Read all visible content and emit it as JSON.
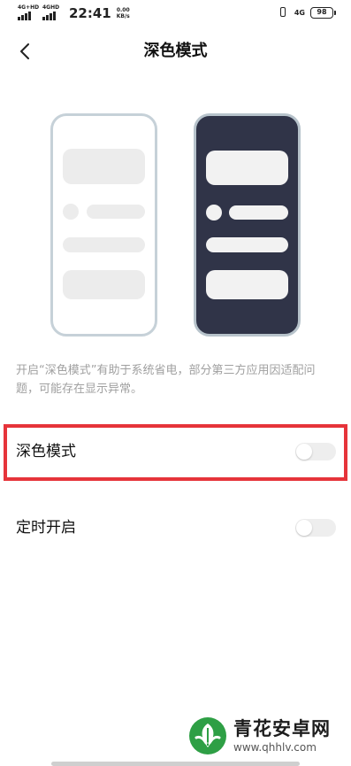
{
  "status_bar": {
    "sim1_label": "4G+HD",
    "sim2_label": "4GHD",
    "time": "22:41",
    "net_speed_value": "0.00",
    "net_speed_unit": "KB/s",
    "network_type": "4G",
    "battery": "98"
  },
  "header": {
    "back_icon": "chevron-left-icon",
    "title": "深色模式"
  },
  "preview": {
    "light_theme": "light-phone-illustration",
    "dark_theme": "dark-phone-illustration",
    "colors": {
      "dark_bg": "#303448",
      "light_border": "#c6d1d8"
    }
  },
  "description": "开启“深色模式”有助于系统省电，部分第三方应用因适配问题，可能存在显示异常。",
  "settings": [
    {
      "label": "深色模式",
      "enabled": false
    },
    {
      "label": "定时开启",
      "enabled": false
    }
  ],
  "watermark": {
    "name": "青花安卓网",
    "url": "www.qhhlv.com"
  },
  "accent": {
    "highlight_border": "#e6343a"
  }
}
